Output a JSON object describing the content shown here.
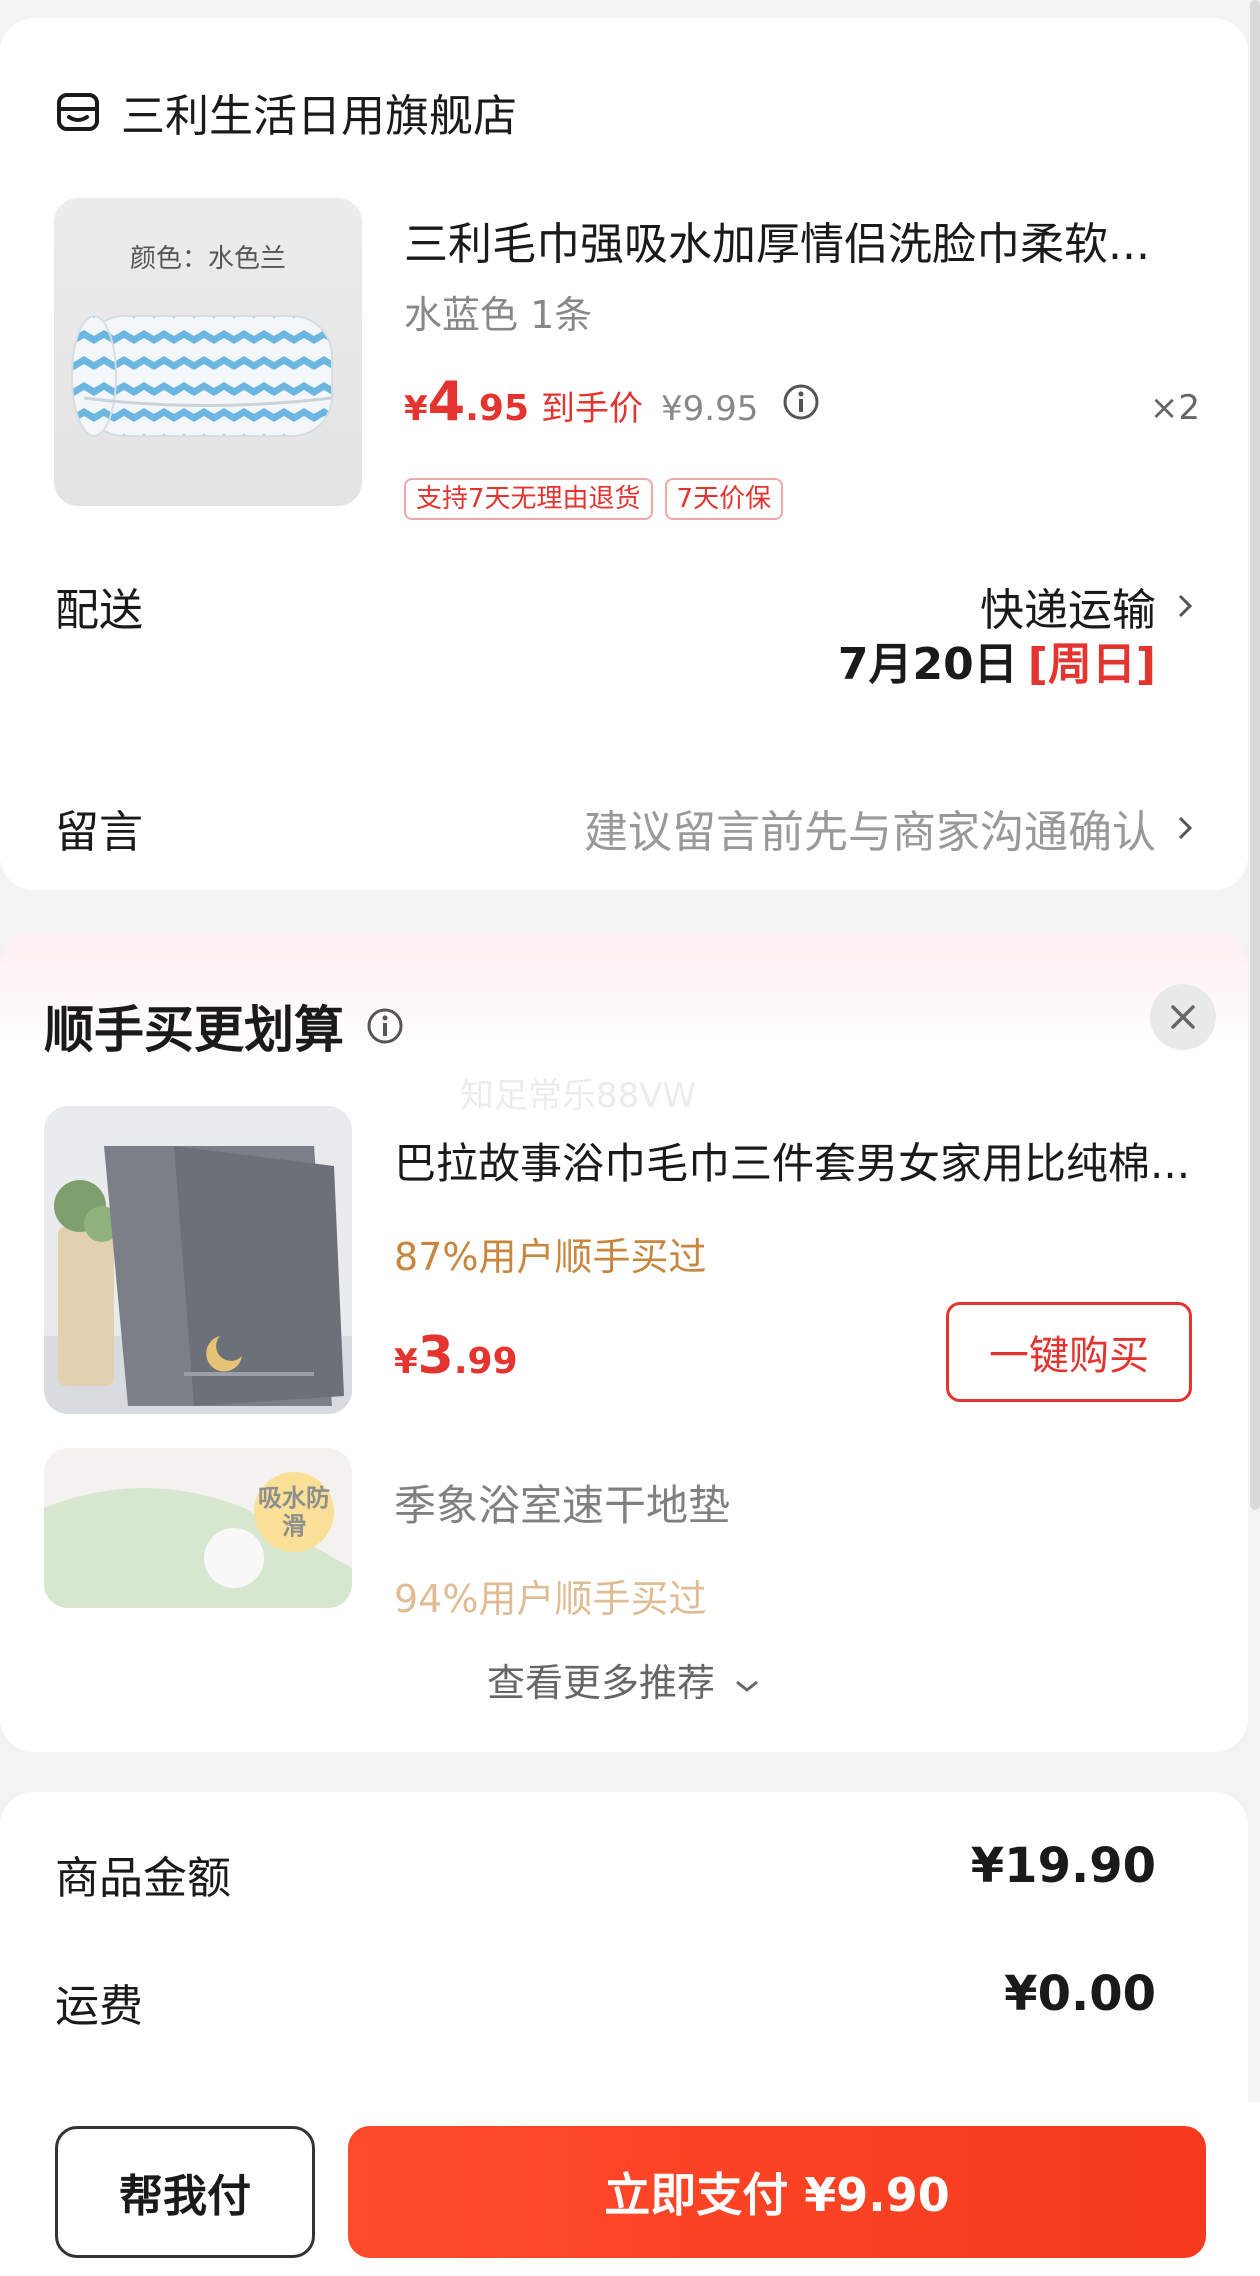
{
  "store": {
    "name": "三利生活日用旗舰店",
    "product": {
      "thumb_caption": "颜色：水色兰",
      "title": "三利毛巾强吸水加厚情侣洗脸巾柔软...",
      "variant": "水蓝色 1条",
      "price_symbol": "¥",
      "price_int": "4",
      "price_dec": ".95",
      "price_label": "到手价",
      "price_original": "¥9.95",
      "quantity": "×2",
      "tags": [
        "支持7天无理由退货",
        "7天价保"
      ]
    },
    "delivery": {
      "label": "配送",
      "method": "快递运输",
      "date": "7月20日",
      "day": "[周日]"
    },
    "message": {
      "label": "留言",
      "placeholder": "建议留言前先与商家沟通确认"
    }
  },
  "recommend": {
    "title": "顺手买更划算",
    "watermark": "知足常乐88VW",
    "items": [
      {
        "name": "巴拉故事浴巾毛巾三件套男女家用比纯棉...",
        "bought": "87%用户顺手买过",
        "price_symbol": "¥",
        "price_int": "3",
        "price_dec": ".99",
        "buy_label": "一键购买"
      },
      {
        "name": "季象浴室速干地垫",
        "bought": "94%用户顺手买过",
        "badge": "吸水防滑"
      }
    ],
    "more_label": "查看更多推荐"
  },
  "summary": {
    "goods_label": "商品金额",
    "goods_value": "¥19.90",
    "shipping_label": "运费",
    "shipping_value": "¥0.00"
  },
  "bottom": {
    "help_label": "帮我付",
    "pay_label": "立即支付 ¥9.90"
  },
  "colors": {
    "accent": "#e3342f",
    "pay_gradient_start": "#ff4b2b",
    "bought_text": "#c8873e"
  }
}
